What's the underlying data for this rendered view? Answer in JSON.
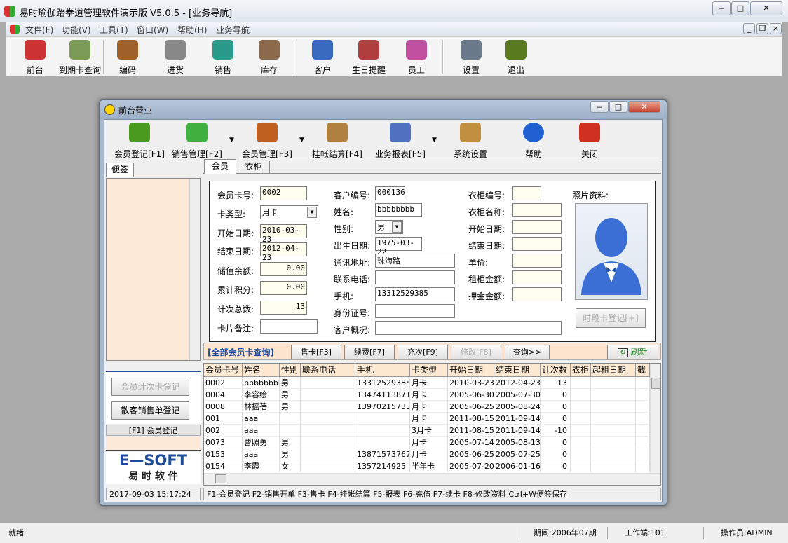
{
  "app": {
    "title": "易时瑜伽跆拳道管理软件演示版 V5.0.5 - [业务导航]"
  },
  "menu": [
    "文件(F)",
    "功能(V)",
    "工具(T)",
    "窗口(W)",
    "帮助(H)",
    "业务导航"
  ],
  "toolbar": [
    {
      "label": "前台",
      "icon": "people-icon",
      "color": "#c33"
    },
    {
      "label": "到期卡查询",
      "icon": "cash-icon",
      "color": "#7a9a55"
    },
    {
      "label": "编码",
      "icon": "boxes-icon",
      "color": "#a0602a"
    },
    {
      "label": "进货",
      "icon": "printer-icon",
      "color": "#888"
    },
    {
      "label": "销售",
      "icon": "money-bag-icon",
      "color": "#2a9a8a"
    },
    {
      "label": "库存",
      "icon": "storage-icon",
      "color": "#8a6a4a"
    },
    {
      "label": "客户",
      "icon": "customer-icon",
      "color": "#3a6ac0"
    },
    {
      "label": "生日提醒",
      "icon": "cake-icon",
      "color": "#b04040"
    },
    {
      "label": "员工",
      "icon": "staff-icon",
      "color": "#c050a0"
    },
    {
      "label": "设置",
      "icon": "tools-icon",
      "color": "#6a7a8a"
    },
    {
      "label": "退出",
      "icon": "exit-door-icon",
      "color": "#5a7a20"
    }
  ],
  "status": {
    "ready": "就绪",
    "period": "期间:2006年07期",
    "workstation": "工作端:101",
    "operator": "操作员:ADMIN"
  },
  "window": {
    "title": "前台营业",
    "toolbar": [
      {
        "label": "会员登记[F1]",
        "icon": "member-register-icon",
        "color": "#4a9a20"
      },
      {
        "label": "销售管理[F2]",
        "icon": "sales-icon",
        "color": "#40b040"
      },
      {
        "label": "会员管理[F3]",
        "icon": "member-manage-icon",
        "color": "#c06020"
      },
      {
        "label": "挂帐结算[F4]",
        "icon": "money-bag-icon",
        "color": "#b08040"
      },
      {
        "label": "业务报表[F5]",
        "icon": "report-icon",
        "color": "#5070c0"
      },
      {
        "label": "系统设置",
        "icon": "settings-icon",
        "color": "#c09040"
      },
      {
        "label": "帮助",
        "icon": "help-icon",
        "color": "#2060d0"
      },
      {
        "label": "关闭",
        "icon": "close-power-icon",
        "color": "#d03020"
      }
    ],
    "left": {
      "tab": "便签",
      "btn_count_card": "会员计次卡登记",
      "btn_walkin": "散客销售单登记",
      "f1_label": "[F1] 会员登记",
      "logo_en": "E—SOFT",
      "logo_cn": "易 时 软 件",
      "datetime": "2017-09-03 15:17:24"
    },
    "tabs": [
      "会员",
      "衣柜"
    ],
    "form": {
      "card_no_label": "会员卡号:",
      "card_no": "0002",
      "card_type_label": "卡类型:",
      "card_type": "月卡",
      "start_label": "开始日期:",
      "start": "2010-03-23",
      "end_label": "结束日期:",
      "end": "2012-04-23",
      "balance_label": "储值余额:",
      "balance": "0.00",
      "points_label": "累计积分:",
      "points": "0.00",
      "count_label": "计次总数:",
      "count": "13",
      "note_label": "卡片备注:",
      "note": "",
      "cust_no_label": "客户编号:",
      "cust_no": "000136",
      "name_label": "姓名:",
      "name": "bbbbbbbb",
      "gender_label": "性别:",
      "gender": "男",
      "birth_label": "出生日期:",
      "birth": "1975-03-22",
      "address_label": "通讯地址:",
      "address": "珠海路",
      "phone_label": "联系电话:",
      "phone": "",
      "mobile_label": "手机:",
      "mobile": "13312529385",
      "id_label": "身份证号:",
      "id": "",
      "overview_label": "客户概况:",
      "overview": "",
      "locker_no_label": "衣柜编号:",
      "locker_name_label": "衣柜名称:",
      "locker_start_label": "开始日期:",
      "locker_end_label": "结束日期:",
      "price_label": "单价:",
      "rent_label": "租柜金额:",
      "deposit_label": "押金金额:",
      "photo_label": "照片资料:",
      "timecard_btn": "时段卡登记[+]"
    },
    "actions": {
      "query_all": "[全部会员卡查询]",
      "sell": "售卡[F3]",
      "renew": "续费[F7]",
      "recharge": "充次[F9]",
      "modify": "修改[F8]",
      "search": "查询>>",
      "refresh": "刷新"
    },
    "grid": {
      "columns": [
        "会员卡号",
        "姓名",
        "性别",
        "联系电话",
        "手机",
        "卡类型",
        "开始日期",
        "结束日期",
        "计次数",
        "衣柜",
        "起租日期",
        "截"
      ],
      "rows": [
        [
          "0002",
          "bbbbbbbb",
          "男",
          "",
          "13312529385",
          "月卡",
          "2010-03-23",
          "2012-04-23",
          "13",
          "",
          "",
          ""
        ],
        [
          "0004",
          "李容绘",
          "男",
          "",
          "13474113871",
          "月卡",
          "2005-06-30",
          "2005-07-30",
          "0",
          "",
          "",
          ""
        ],
        [
          "0008",
          "林摇蓓",
          "男",
          "",
          "13970215733",
          "月卡",
          "2005-06-25",
          "2005-08-24",
          "0",
          "",
          "",
          ""
        ],
        [
          "001",
          "aaa",
          "",
          "",
          "",
          "月卡",
          "2011-08-15",
          "2011-09-14",
          "0",
          "",
          "",
          ""
        ],
        [
          "002",
          "aaa",
          "",
          "",
          "",
          "3月卡",
          "2011-08-15",
          "2011-09-14",
          "-10",
          "",
          "",
          ""
        ],
        [
          "0073",
          "曹照勇",
          "男",
          "",
          "",
          "月卡",
          "2005-07-14",
          "2005-08-13",
          "0",
          "",
          "",
          ""
        ],
        [
          "0153",
          "aaa",
          "男",
          "",
          "13871573767",
          "月卡",
          "2005-06-25",
          "2005-07-25",
          "0",
          "",
          "",
          ""
        ],
        [
          "0154",
          "李霞",
          "女",
          "",
          "1357214925",
          "半年卡",
          "2005-07-20",
          "2006-01-16",
          "0",
          "",
          "",
          ""
        ]
      ]
    },
    "hint": "F1-会员登记 F2-销售开单 F3-售卡 F4-挂帐结算 F5-报表 F6-充值 F7-续卡 F8-修改资料 Ctrl+W便签保存"
  }
}
